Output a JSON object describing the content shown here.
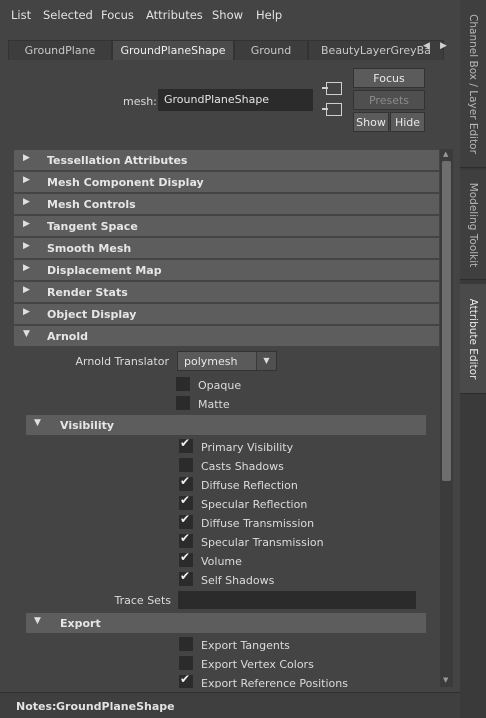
{
  "menu": {
    "items": [
      "List",
      "Selected",
      "Focus",
      "Attributes",
      "Show",
      "Help"
    ]
  },
  "right_tabs": [
    "Channel Box / Layer Editor",
    "Modeling Toolkit",
    "Attribute Editor"
  ],
  "node_tabs": {
    "items": [
      "GroundPlane",
      "GroundPlaneShape",
      "Ground",
      "BeautyLayerGreyBa"
    ],
    "active": "GroundPlaneShape",
    "prev_icon": "◀",
    "next_icon": "▶"
  },
  "mesh": {
    "label": "mesh:",
    "value": "GroundPlaneShape"
  },
  "buttons": {
    "focus": "Focus",
    "presets": "Presets",
    "show": "Show",
    "hide": "Hide"
  },
  "sections": [
    {
      "label": "Tessellation Attributes",
      "expanded": false
    },
    {
      "label": "Mesh Component Display",
      "expanded": false
    },
    {
      "label": "Mesh Controls",
      "expanded": false
    },
    {
      "label": "Tangent Space",
      "expanded": false
    },
    {
      "label": "Smooth Mesh",
      "expanded": false
    },
    {
      "label": "Displacement Map",
      "expanded": false
    },
    {
      "label": "Render Stats",
      "expanded": false
    },
    {
      "label": "Object Display",
      "expanded": false
    },
    {
      "label": "Arnold",
      "expanded": true
    }
  ],
  "arnold": {
    "translator_label": "Arnold Translator",
    "translator_value": "polymesh",
    "opaque": {
      "label": "Opaque",
      "checked": false
    },
    "matte": {
      "label": "Matte",
      "checked": false
    },
    "visibility": {
      "label": "Visibility",
      "items": [
        {
          "label": "Primary Visibility",
          "checked": true
        },
        {
          "label": "Casts Shadows",
          "checked": false
        },
        {
          "label": "Diffuse Reflection",
          "checked": true
        },
        {
          "label": "Specular Reflection",
          "checked": true
        },
        {
          "label": "Diffuse Transmission",
          "checked": true
        },
        {
          "label": "Specular Transmission",
          "checked": true
        },
        {
          "label": "Volume",
          "checked": true
        },
        {
          "label": "Self Shadows",
          "checked": true
        }
      ]
    },
    "trace_sets_label": "Trace Sets",
    "trace_sets_value": "",
    "export": {
      "label": "Export",
      "items": [
        {
          "label": "Export Tangents",
          "checked": false
        },
        {
          "label": "Export Vertex Colors",
          "checked": false
        },
        {
          "label": "Export Reference Positions",
          "checked": true
        }
      ]
    }
  },
  "notes": {
    "label": "Notes:",
    "value": "GroundPlaneShape"
  },
  "icons": {
    "collapsed": "▶",
    "expanded": "▼",
    "check": "✔",
    "dropdown": "▼",
    "scroll_up": "▲",
    "scroll_down": "▼"
  }
}
